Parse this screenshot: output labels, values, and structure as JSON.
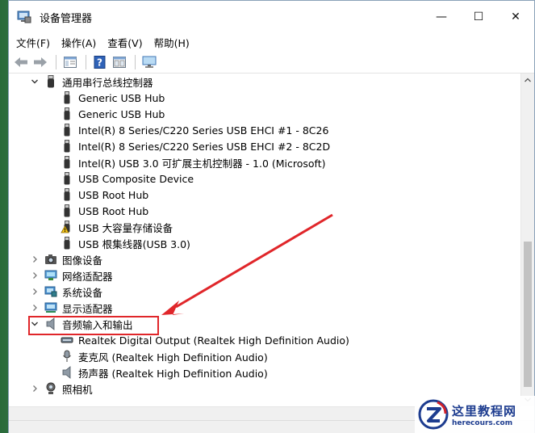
{
  "window": {
    "title": "设备管理器",
    "controls": {
      "minimize": "—",
      "maximize": "☐",
      "close": "✕"
    }
  },
  "menu": [
    "文件(F)",
    "操作(A)",
    "查看(V)",
    "帮助(H)"
  ],
  "toolbar": [
    "back-icon",
    "forward-icon",
    "properties-icon",
    "help-icon",
    "view-icon",
    "monitor-icon"
  ],
  "tree": [
    {
      "label": "通用串行总线控制器",
      "level": 1,
      "expander": "expanded",
      "icon": "usb-controller-icon"
    },
    {
      "label": "Generic USB Hub",
      "level": 2,
      "icon": "usb-plug-icon"
    },
    {
      "label": "Generic USB Hub",
      "level": 2,
      "icon": "usb-plug-icon"
    },
    {
      "label": "Intel(R) 8 Series/C220 Series USB EHCI #1 - 8C26",
      "level": 2,
      "icon": "usb-plug-icon"
    },
    {
      "label": "Intel(R) 8 Series/C220 Series USB EHCI #2 - 8C2D",
      "level": 2,
      "icon": "usb-plug-icon"
    },
    {
      "label": "Intel(R) USB 3.0 可扩展主机控制器 - 1.0 (Microsoft)",
      "level": 2,
      "icon": "usb-plug-icon"
    },
    {
      "label": "USB Composite Device",
      "level": 2,
      "icon": "usb-plug-icon"
    },
    {
      "label": "USB Root Hub",
      "level": 2,
      "icon": "usb-plug-icon"
    },
    {
      "label": "USB Root Hub",
      "level": 2,
      "icon": "usb-plug-icon"
    },
    {
      "label": "USB 大容量存储设备",
      "level": 2,
      "icon": "usb-warning-icon"
    },
    {
      "label": "USB 根集线器(USB 3.0)",
      "level": 2,
      "icon": "usb-plug-icon"
    },
    {
      "label": "图像设备",
      "level": 1,
      "expander": "collapsed",
      "icon": "camera-icon"
    },
    {
      "label": "网络适配器",
      "level": 1,
      "expander": "collapsed",
      "icon": "network-icon"
    },
    {
      "label": "系统设备",
      "level": 1,
      "expander": "collapsed",
      "icon": "system-icon"
    },
    {
      "label": "显示适配器",
      "level": 1,
      "expander": "collapsed",
      "icon": "display-icon"
    },
    {
      "label": "音频输入和输出",
      "level": 1,
      "expander": "expanded",
      "icon": "speaker-icon"
    },
    {
      "label": "Realtek Digital Output (Realtek High Definition Audio)",
      "level": 2,
      "icon": "digital-output-icon"
    },
    {
      "label": "麦克风 (Realtek High Definition Audio)",
      "level": 2,
      "icon": "microphone-icon"
    },
    {
      "label": "扬声器 (Realtek High Definition Audio)",
      "level": 2,
      "icon": "speaker-icon"
    },
    {
      "label": "照相机",
      "level": 1,
      "expander": "collapsed",
      "icon": "webcam-icon"
    }
  ],
  "watermark": {
    "cn": "这里教程网",
    "en": "herecours.com"
  },
  "colors": {
    "highlight": "#e0262a",
    "watermark": "#1d3c8f"
  }
}
